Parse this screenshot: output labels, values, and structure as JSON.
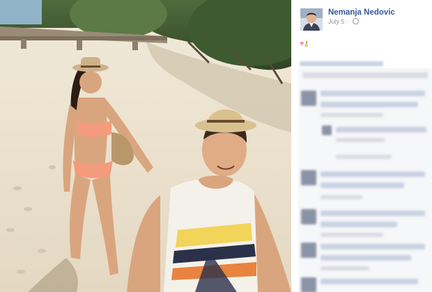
{
  "post": {
    "author": "Nemanja Nedovic",
    "date": "July 5",
    "separator": "·",
    "reaction_icons": [
      "heart-icon",
      "key-icon"
    ],
    "privacy_icon": "globe-icon"
  },
  "colors": {
    "author_link": "#365899",
    "meta_text": "#90949c",
    "comments_panel": "#f6f7f9"
  }
}
